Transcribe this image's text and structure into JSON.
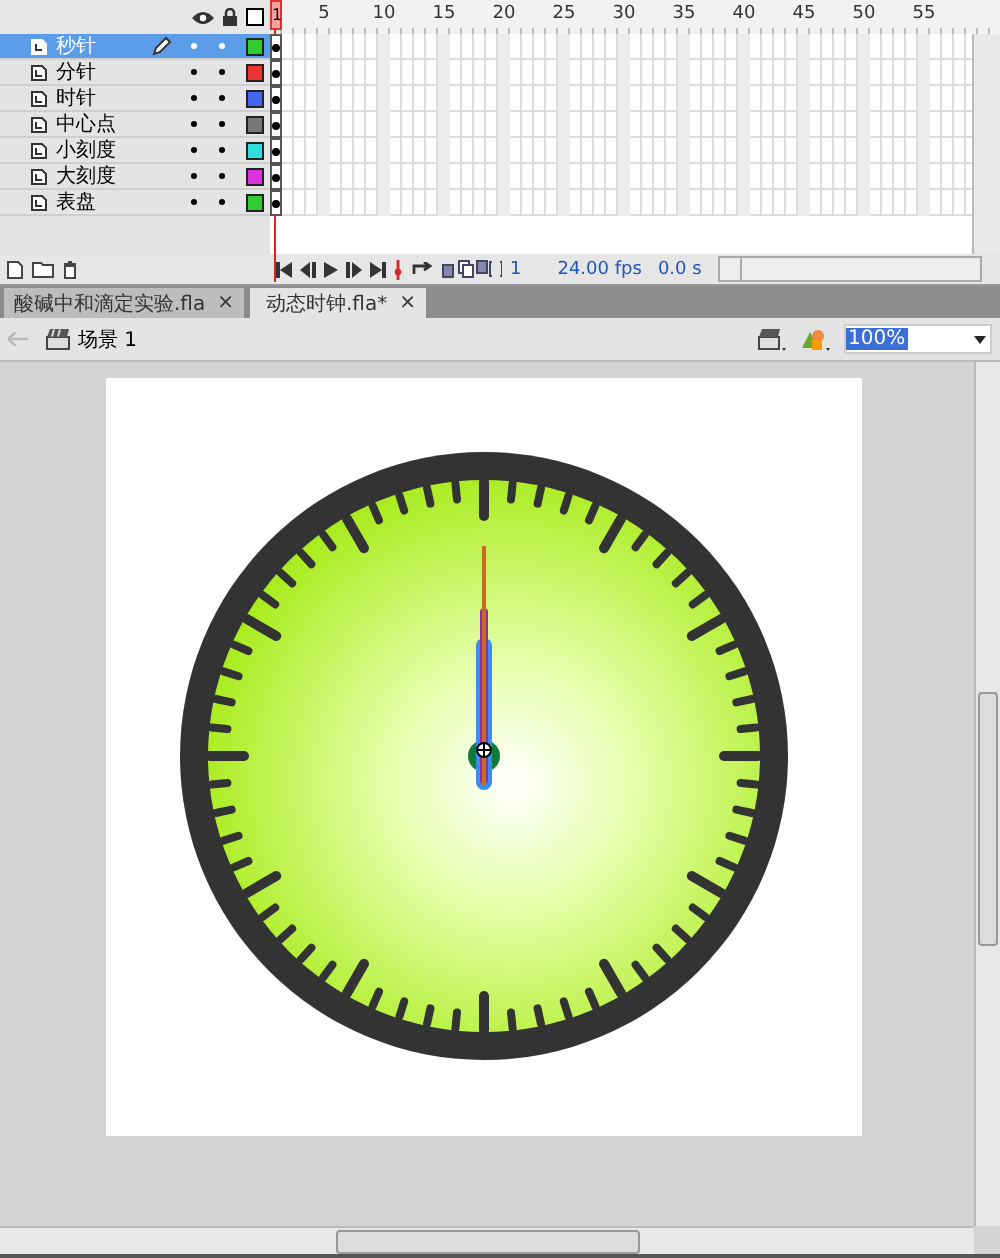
{
  "timeline": {
    "ruler": [
      {
        "label": "1",
        "current": true
      },
      {
        "label": "5",
        "current": false
      },
      {
        "label": "10",
        "current": false
      },
      {
        "label": "15",
        "current": false
      },
      {
        "label": "20",
        "current": false
      },
      {
        "label": "25",
        "current": false
      },
      {
        "label": "30",
        "current": false
      },
      {
        "label": "35",
        "current": false
      },
      {
        "label": "40",
        "current": false
      },
      {
        "label": "45",
        "current": false
      },
      {
        "label": "50",
        "current": false
      },
      {
        "label": "55",
        "current": false
      }
    ],
    "layers": [
      {
        "name": "秒针",
        "selected": true,
        "editing": true,
        "visible": true,
        "locked": false,
        "color": "#33cc33"
      },
      {
        "name": "分针",
        "selected": false,
        "editing": false,
        "visible": true,
        "locked": false,
        "color": "#ee3333"
      },
      {
        "name": "时针",
        "selected": false,
        "editing": false,
        "visible": true,
        "locked": false,
        "color": "#4466ee"
      },
      {
        "name": "中心点",
        "selected": false,
        "editing": false,
        "visible": true,
        "locked": false,
        "color": "#777777"
      },
      {
        "name": "小刻度",
        "selected": false,
        "editing": false,
        "visible": true,
        "locked": false,
        "color": "#33dddd"
      },
      {
        "name": "大刻度",
        "selected": false,
        "editing": false,
        "visible": true,
        "locked": false,
        "color": "#dd33dd"
      },
      {
        "name": "表盘",
        "selected": false,
        "editing": false,
        "visible": true,
        "locked": false,
        "color": "#33cc33"
      }
    ],
    "status": {
      "frame": "1",
      "fps": "24.00 fps",
      "time": "0.0 s"
    }
  },
  "tabs": [
    {
      "label": "酸碱中和滴定实验.fla",
      "close": "×",
      "selected": false
    },
    {
      "label": "动态时钟.fla*",
      "close": "×",
      "selected": true
    }
  ],
  "scene": {
    "label": "场景 1"
  },
  "zoom": {
    "value": "100%"
  }
}
